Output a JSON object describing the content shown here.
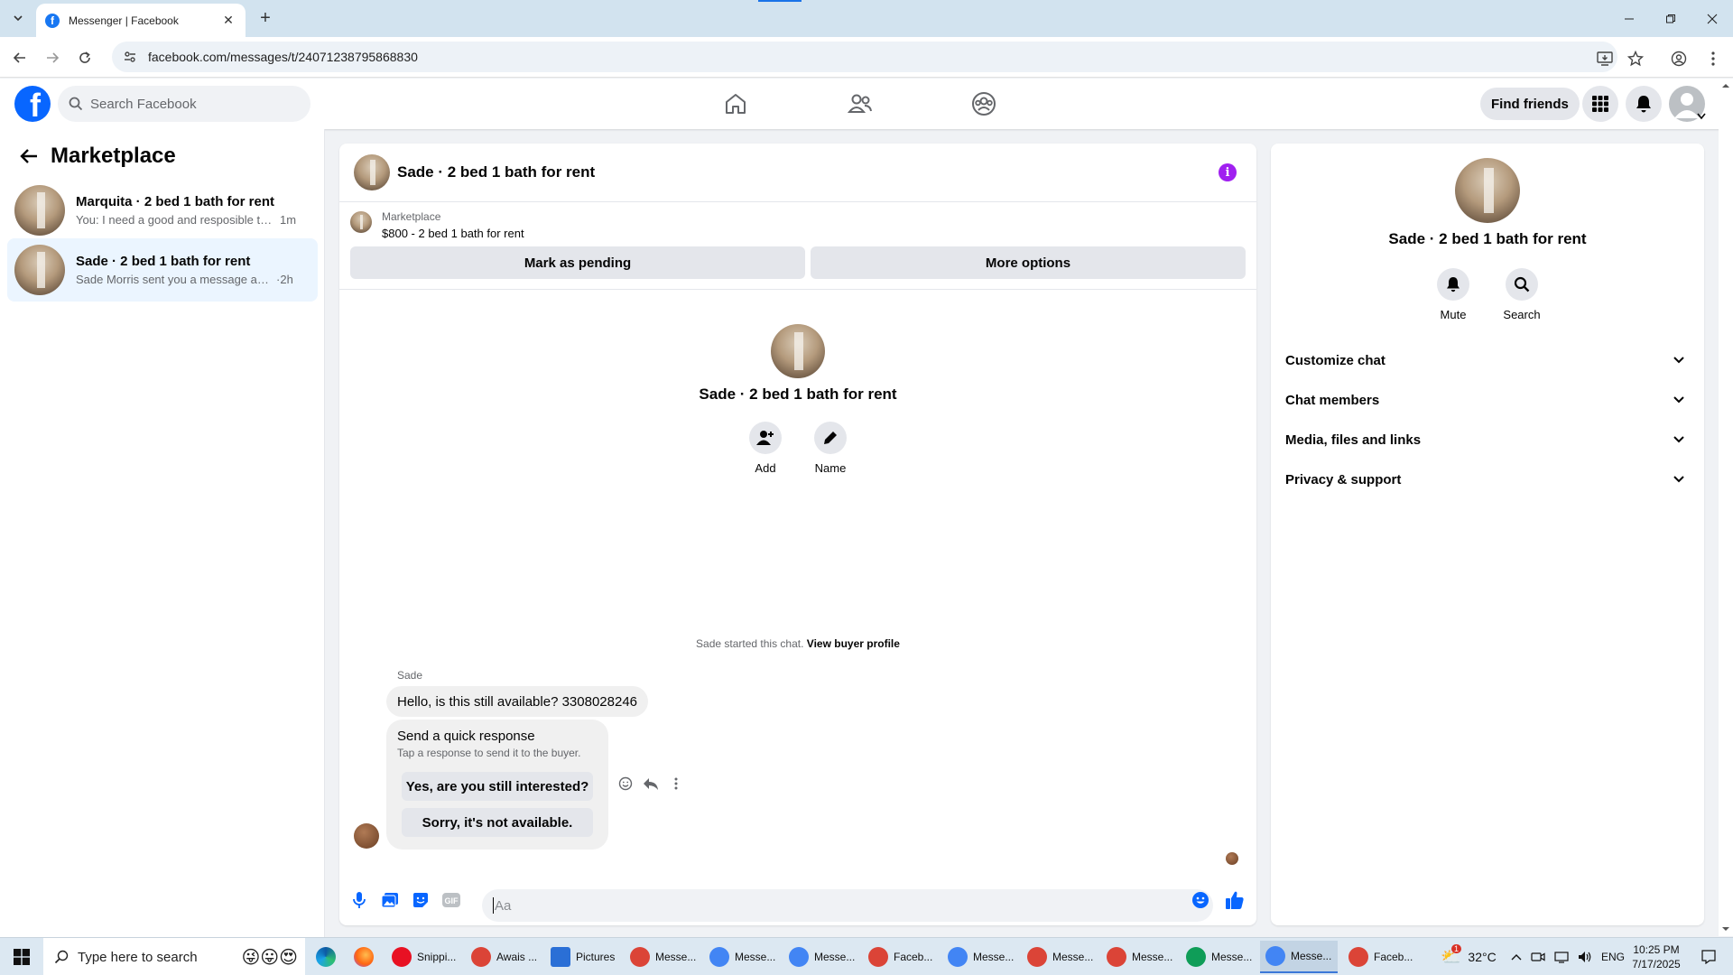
{
  "browser": {
    "tab_title": "Messenger | Facebook",
    "url": "facebook.com/messages/t/24071238795868830"
  },
  "fb": {
    "logo_letter": "f",
    "search_placeholder": "Search Facebook",
    "find_friends": "Find friends"
  },
  "sidebar": {
    "title": "Marketplace",
    "conversations": [
      {
        "name": "Marquita · 2 bed 1 bath for rent",
        "snippet": "You: I need a good and resposible te...",
        "time": "1m"
      },
      {
        "name": "Sade · 2 bed 1 bath for rent",
        "snippet": "Sade Morris sent you a message abou...",
        "time": "2h"
      }
    ]
  },
  "chat": {
    "title": "Sade · 2 bed 1 bath for rent",
    "listing_label": "Marketplace",
    "listing_price": "$800 - 2 bed 1 bath for rent",
    "mark_pending": "Mark as pending",
    "more_options": "More options",
    "intro_name": "Sade · 2 bed 1 bath for rent",
    "add_label": "Add",
    "name_label": "Name",
    "started_text": "Sade started this chat.",
    "view_buyer_profile": "View buyer profile",
    "sender": "Sade",
    "message": "Hello, is this still available? 3308028246",
    "quick_title": "Send a quick response",
    "quick_sub": "Tap a response to send it to the buyer.",
    "quick_replies": [
      "Yes, are you still interested?",
      "Sorry, it's not available."
    ],
    "composer_placeholder": "Aa"
  },
  "right_panel": {
    "name": "Sade · 2 bed 1 bath for rent",
    "mute": "Mute",
    "search": "Search",
    "sections": [
      "Customize chat",
      "Chat members",
      "Media, files and links",
      "Privacy & support"
    ]
  },
  "taskbar": {
    "search_placeholder": "Type here to search",
    "apps": [
      "Snippi...",
      "Awais ...",
      "Pictures",
      "Messe...",
      "Messe...",
      "Messe...",
      "Faceb...",
      "Messe...",
      "Messe...",
      "Messe...",
      "Messe...",
      "Messe...",
      "Faceb..."
    ],
    "weather_badge": "1",
    "temperature": "32°C",
    "language": "ENG",
    "time": "10:25 PM",
    "date": "7/17/2025"
  },
  "colors": {
    "fb_blue": "#0866ff",
    "active_conv_bg": "#ebf5ff",
    "info_purple": "#a020f0",
    "composer_icon_blue": "#0866ff"
  }
}
